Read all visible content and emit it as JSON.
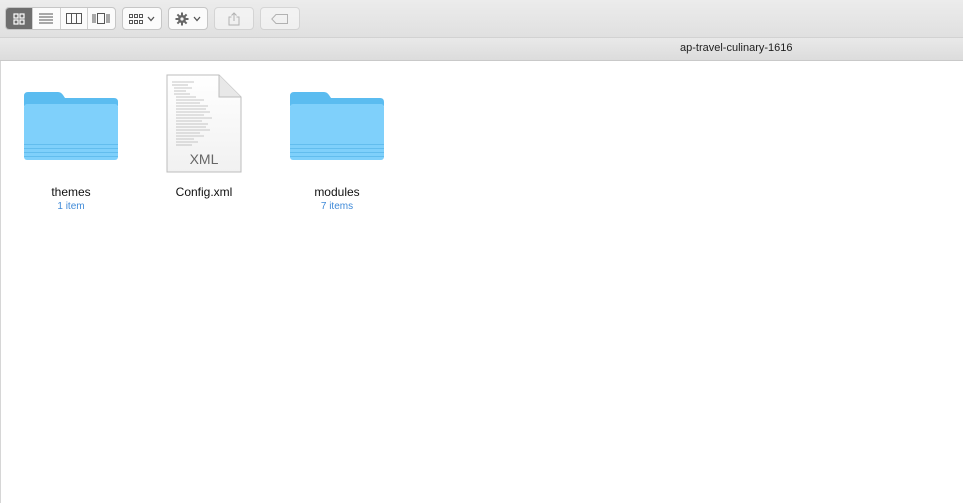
{
  "window": {
    "path_title": "ap-travel-culinary-1616"
  },
  "toolbar": {
    "view_modes": [
      {
        "name": "icon-view",
        "icon": "grid-icon",
        "active": true
      },
      {
        "name": "list-view",
        "icon": "list-icon",
        "active": false
      },
      {
        "name": "column-view",
        "icon": "columns-icon",
        "active": false
      },
      {
        "name": "cover-flow-view",
        "icon": "cover-flow-icon",
        "active": false
      }
    ],
    "arrange_icon": "group-grid-icon",
    "action_icon": "gear-icon",
    "share_icon": "share-icon",
    "tag_icon": "tag-icon"
  },
  "items": [
    {
      "name": "themes",
      "sub": "1 item",
      "kind": "folder"
    },
    {
      "name": "Config.xml",
      "sub": "",
      "kind": "xml-file",
      "file_badge": "XML"
    },
    {
      "name": "modules",
      "sub": "7 items",
      "kind": "folder"
    }
  ],
  "colors": {
    "folder_blue": "#7fd0fb",
    "folder_dark": "#5bbcf0",
    "subtitle_blue": "#3f8ad8",
    "active_segment": "#6e6e6e"
  }
}
